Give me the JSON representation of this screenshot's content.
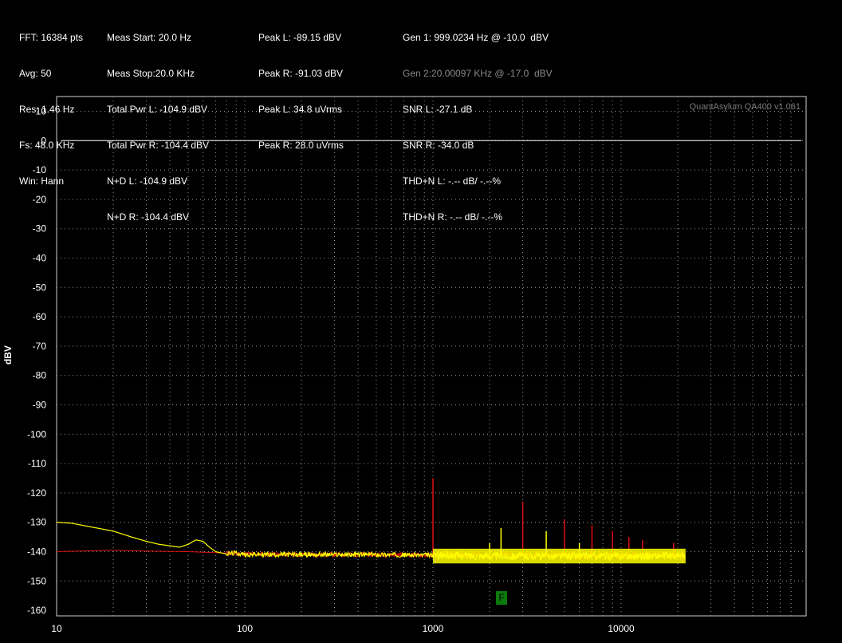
{
  "stats": {
    "col1": [
      "FFT: 16384 pts",
      "Avg: 50",
      "Res: 1.46 Hz",
      "Fs: 48.0 KHz",
      "Win: Hann"
    ],
    "col2": [
      "Meas Start: 20.0 Hz",
      "Meas Stop:20.0 KHz",
      "Total Pwr L: -104.9 dBV",
      "Total Pwr R: -104.4 dBV",
      "N+D L: -104.9 dBV",
      "N+D R: -104.4 dBV"
    ],
    "col3": [
      "Peak L: -89.15 dBV",
      "Peak R: -91.03 dBV",
      "Peak L: 34.8 uVrms",
      "Peak R: 28.0 uVrms"
    ],
    "col4": [
      "Gen 1: 999.0234 Hz @ -10.0  dBV",
      "Gen 2:20.00097 KHz @ -17.0  dBV",
      "SNR L: -27.1 dB",
      "SNR R: -34.0 dB",
      "THD+N L: -.-- dB/ -.--%",
      "THD+N R: -.-- dB/ -.--%"
    ]
  },
  "watermark": "QuantAsylum QA400 v1.061",
  "marker_label": "F",
  "colors": {
    "left_channel": "#ffff00",
    "right_channel": "#e01010",
    "grid": "#9a9a9a",
    "background": "#000000",
    "marker": "#0d7a0d",
    "reference_line": "#ffffff"
  },
  "chart_data": {
    "type": "line",
    "xlabel": "",
    "ylabel": "dBV",
    "x_scale": "log",
    "xlim": [
      10,
      80000
    ],
    "ylim": [
      -160,
      10
    ],
    "x_ticks": [
      10,
      100,
      1000,
      10000
    ],
    "x_tick_labels": [
      "10",
      "100",
      "1000",
      "10000"
    ],
    "y_ticks": [
      10,
      0,
      -10,
      -20,
      -30,
      -40,
      -50,
      -60,
      -70,
      -80,
      -90,
      -100,
      -110,
      -120,
      -130,
      -140,
      -150,
      -160
    ],
    "y_tick_labels": [
      "10",
      "0",
      "-10",
      "-20",
      "-30",
      "-40",
      "-50",
      "-60",
      "-70",
      "-80",
      "-90",
      "-100",
      "-110",
      "-120",
      "-130",
      "-140",
      "-150",
      "-160"
    ],
    "grid": true,
    "reference_line": {
      "y": 0,
      "x": [
        10,
        80000
      ]
    },
    "marker": {
      "x": 2200,
      "y": -150
    },
    "series": [
      {
        "color": "#ffff00",
        "points": [
          [
            10,
            -130
          ],
          [
            12,
            -130.3
          ],
          [
            15,
            -131.5
          ],
          [
            20,
            -133
          ],
          [
            25,
            -135
          ],
          [
            30,
            -136.5
          ],
          [
            35,
            -137.5
          ],
          [
            40,
            -138
          ],
          [
            45,
            -138.5
          ],
          [
            50,
            -137.5
          ],
          [
            55,
            -136
          ],
          [
            60,
            -136.5
          ],
          [
            65,
            -138.5
          ],
          [
            70,
            -140
          ],
          [
            80,
            -140.8
          ],
          [
            90,
            -140.5
          ],
          [
            100,
            -141
          ],
          [
            200,
            -141
          ],
          [
            500,
            -141
          ],
          [
            1000,
            -141.2
          ],
          [
            2000,
            -141.5
          ],
          [
            5000,
            -141.5
          ],
          [
            10000,
            -141.5
          ],
          [
            22000,
            -141.5
          ]
        ],
        "noise_band": [
          -144,
          -139
        ],
        "spikes": [
          [
            2000,
            -137
          ],
          [
            2300,
            -132
          ],
          [
            4000,
            -133
          ],
          [
            6000,
            -137
          ]
        ]
      },
      {
        "color": "#e01010",
        "points": [
          [
            10,
            -140
          ],
          [
            20,
            -139.5
          ],
          [
            30,
            -139.8
          ],
          [
            50,
            -140
          ],
          [
            80,
            -140.5
          ],
          [
            100,
            -140.8
          ],
          [
            200,
            -141
          ],
          [
            500,
            -141
          ],
          [
            1000,
            -141.2
          ],
          [
            5000,
            -141.3
          ],
          [
            22000,
            -141.3
          ]
        ],
        "spikes": [
          [
            1000,
            -115
          ],
          [
            3000,
            -123
          ],
          [
            5000,
            -129
          ],
          [
            7000,
            -131
          ],
          [
            9000,
            -133
          ],
          [
            11000,
            -135
          ],
          [
            13000,
            -136
          ],
          [
            19000,
            -137
          ]
        ]
      }
    ]
  }
}
